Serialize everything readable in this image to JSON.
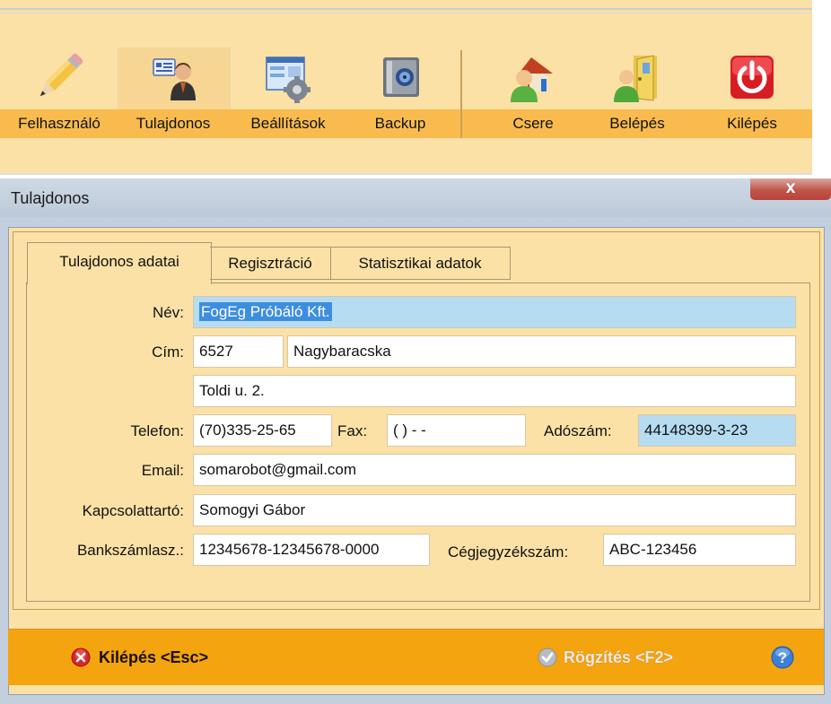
{
  "toolbar": {
    "items": [
      {
        "label": "Felhasználó",
        "icon": "pencil-icon"
      },
      {
        "label": "Tulajdonos",
        "icon": "owner-card-icon"
      },
      {
        "label": "Beállítások",
        "icon": "settings-gear-icon"
      },
      {
        "label": "Backup",
        "icon": "safe-icon"
      },
      {
        "label": "Csere",
        "icon": "user-house-icon"
      },
      {
        "label": "Belépés",
        "icon": "user-door-icon"
      },
      {
        "label": "Kilépés",
        "icon": "power-icon"
      }
    ]
  },
  "dialog": {
    "title": "Tulajdonos",
    "close_label": "x",
    "tabs": [
      {
        "label": "Tulajdonos adatai",
        "active": true
      },
      {
        "label": "Regisztráció",
        "active": false
      },
      {
        "label": "Statisztikai adatok",
        "active": false
      }
    ],
    "form": {
      "nev_label": "Név:",
      "nev_value": "FogEg Próbáló Kft.",
      "cim_label": "Cím:",
      "zip_value": "6527",
      "city_value": "Nagybaracska",
      "street_value": "Toldi u. 2.",
      "telefon_label": "Telefon:",
      "telefon_value": "(70)335-25-65",
      "fax_label": "Fax:",
      "fax_value": "(  )   -  -",
      "adoszam_label": "Adószám:",
      "adoszam_value": "44148399-3-23",
      "email_label": "Email:",
      "email_value": "somarobot@gmail.com",
      "kapcsolat_label": "Kapcsolattartó:",
      "kapcsolat_value": "Somogyi Gábor",
      "bank_label": "Bankszámlasz.:",
      "bank_value": "12345678-12345678-0000",
      "cegjegyzek_label": "Cégjegyzékszám:",
      "cegjegyzek_value": "ABC-123456"
    },
    "footer": {
      "exit_label": "Kilépés <Esc>",
      "save_label": "Rögzítés <F2>"
    }
  },
  "colors": {
    "toolbar_bg": "#fbe1a6",
    "toolbar_band": "#f9bb4e",
    "footer_bg": "#f4a40f",
    "field_highlight": "#b6dcf2",
    "selection": "#3e8ee0"
  }
}
